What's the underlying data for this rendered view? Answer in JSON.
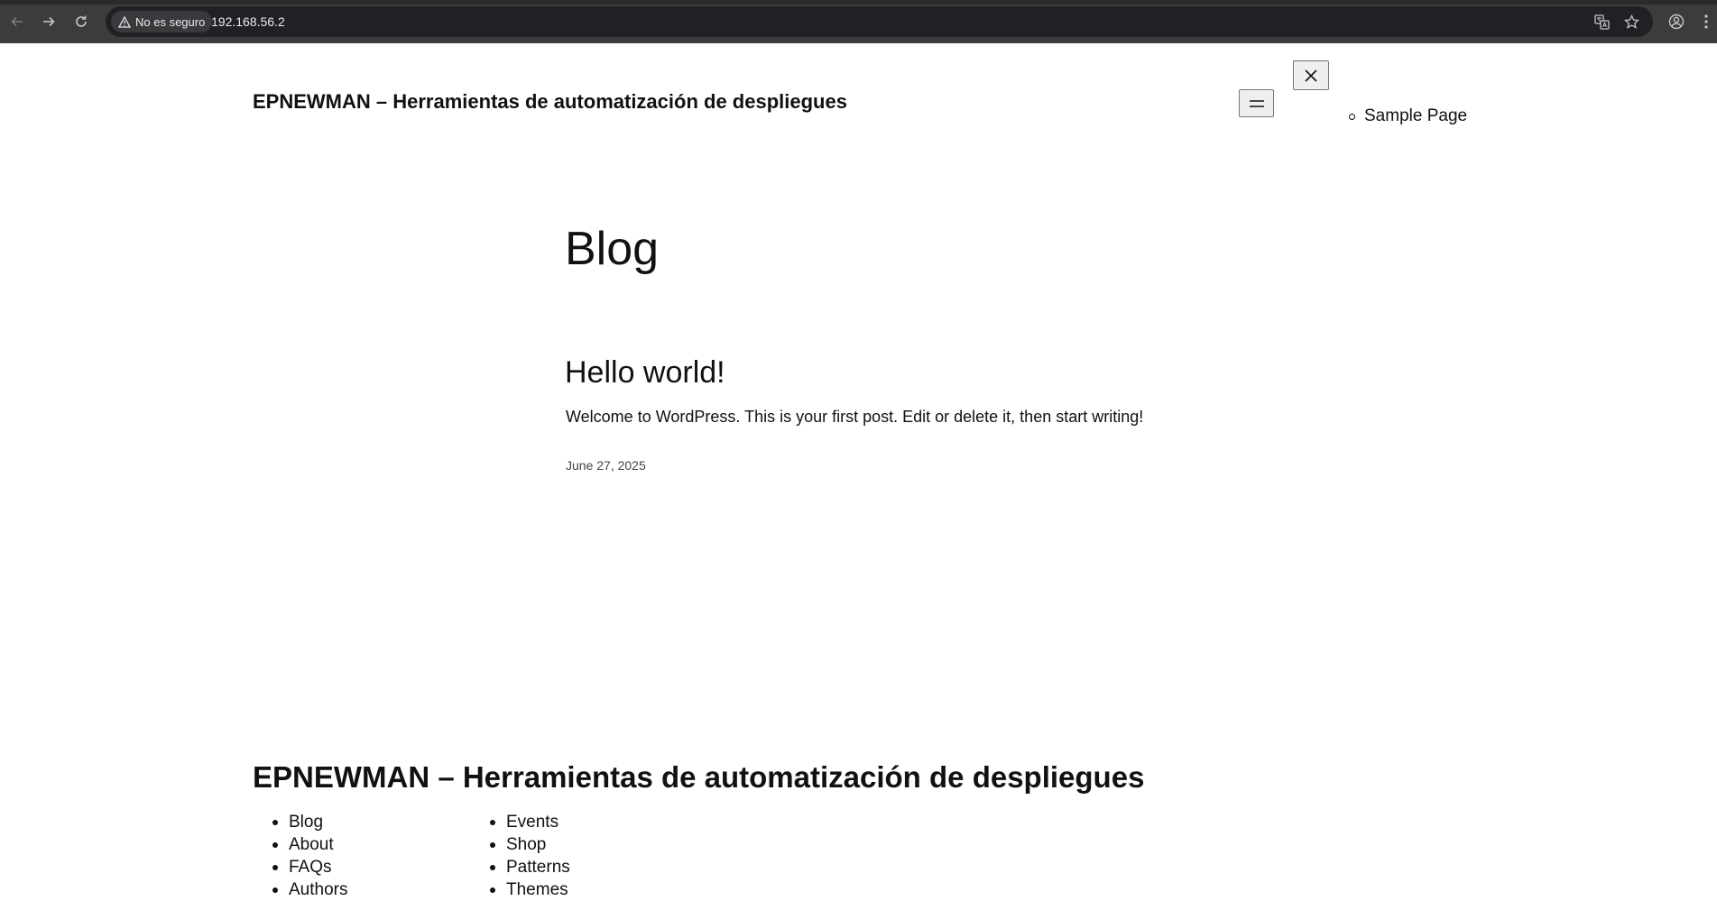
{
  "browser": {
    "security_label": "No es seguro",
    "url": "192.168.56.2",
    "icons": {
      "back": "arrow-left-icon",
      "forward": "arrow-right-icon",
      "reload": "reload-icon",
      "warning": "warning-triangle-icon",
      "translate": "translate-icon",
      "bookmark": "star-icon",
      "profile": "profile-icon",
      "menu": "kebab-menu-icon"
    }
  },
  "header": {
    "site_title": "EPNEWMAN – Herramientas de automatización de despliegues",
    "overlay_menu_items": [
      "Sample Page"
    ]
  },
  "main": {
    "heading": "Blog",
    "posts": [
      {
        "title": "Hello world!",
        "excerpt": "Welcome to WordPress. This is your first post. Edit or delete it, then start writing!",
        "date": "June 27, 2025"
      }
    ]
  },
  "footer": {
    "site_title": "EPNEWMAN – Herramientas de automatización de despliegues",
    "nav_col_1": [
      "Blog",
      "About",
      "FAQs",
      "Authors"
    ],
    "nav_col_2": [
      "Events",
      "Shop",
      "Patterns",
      "Themes"
    ]
  }
}
